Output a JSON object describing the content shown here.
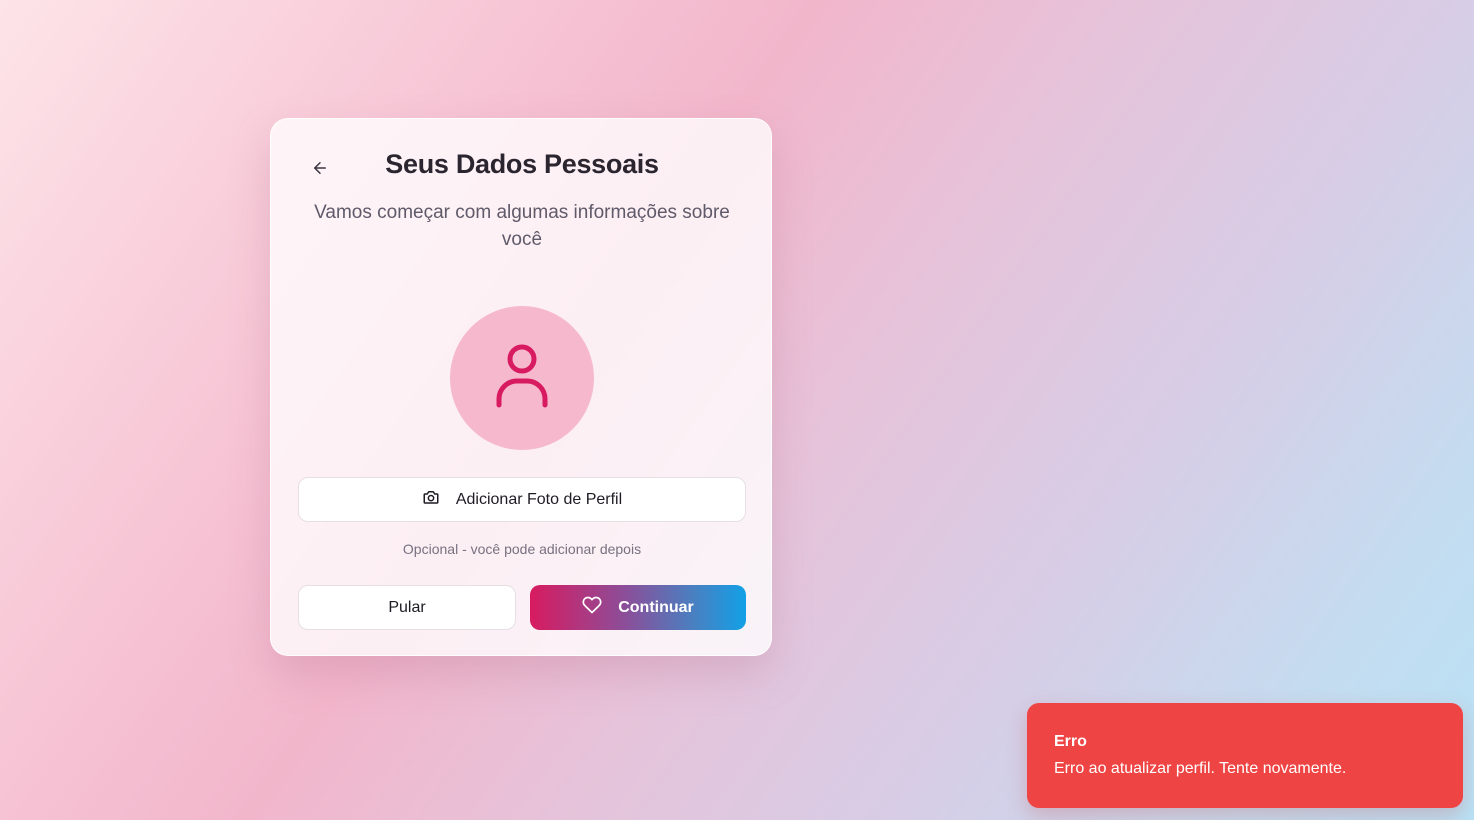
{
  "page": {
    "title": "Seus Dados Pessoais",
    "subtitle": "Vamos começar com algumas informações sobre você"
  },
  "icons": {
    "back": "arrow-left-icon",
    "avatar": "user-icon",
    "camera": "camera-icon",
    "continue": "heart-icon"
  },
  "photo": {
    "button_label": "Adicionar Foto de Perfil",
    "hint": "Opcional - você pode adicionar depois"
  },
  "actions": {
    "skip_label": "Pular",
    "continue_label": "Continuar"
  },
  "toast": {
    "title": "Erro",
    "message": "Erro ao atualizar perfil. Tente novamente."
  },
  "colors": {
    "accent_pink": "#d81b60",
    "accent_blue": "#12a0e6",
    "avatar_bg": "#f5b8cd",
    "error": "#ef4444"
  }
}
